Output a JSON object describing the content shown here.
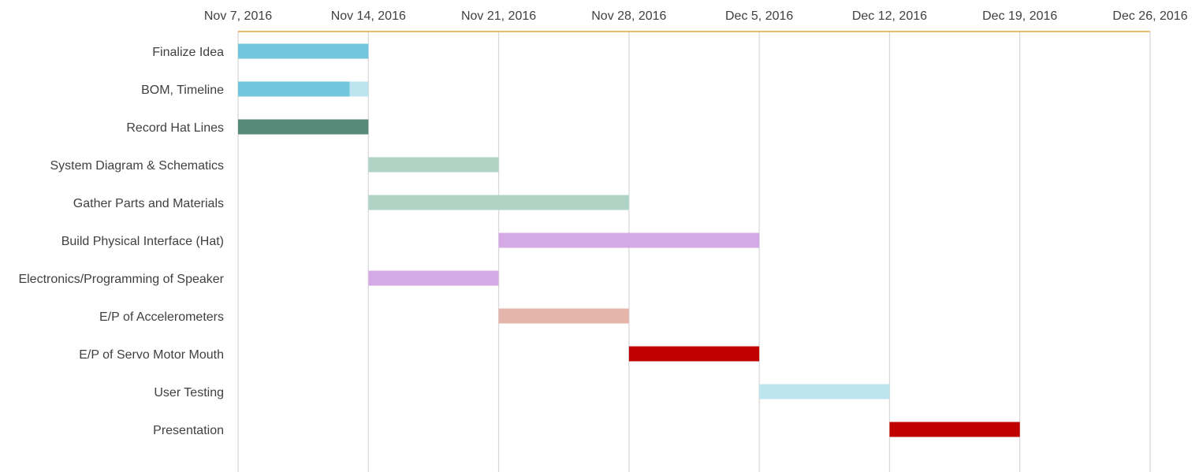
{
  "chart_data": {
    "type": "gantt",
    "title": "",
    "xlabel": "",
    "ylabel": "",
    "x_axis_position": "top",
    "x_ticks": [
      "Nov 7, 2016",
      "Nov 14, 2016",
      "Nov 21, 2016",
      "Nov 28, 2016",
      "Dec 5, 2016",
      "Dec 12, 2016",
      "Dec 19, 2016",
      "Dec 26, 2016"
    ],
    "xlim": [
      "2016-11-07",
      "2016-12-26"
    ],
    "grid": true,
    "legend": "none",
    "colors": {
      "axis_line": "#e8a33d",
      "gridline": "#d9d9d9"
    },
    "tasks": [
      {
        "name": "Finalize Idea",
        "start": "2016-11-07",
        "end": "2016-11-14",
        "segments": [
          {
            "start": "2016-11-07",
            "end": "2016-11-14",
            "color": "#72c7de"
          }
        ]
      },
      {
        "name": "BOM, Timeline",
        "start": "2016-11-07",
        "end": "2016-11-14",
        "segments": [
          {
            "start": "2016-11-07",
            "end": "2016-11-13",
            "color": "#72c7de"
          },
          {
            "start": "2016-11-13",
            "end": "2016-11-14",
            "color": "#bde5f0"
          }
        ]
      },
      {
        "name": "Record Hat Lines",
        "start": "2016-11-07",
        "end": "2016-11-14",
        "segments": [
          {
            "start": "2016-11-07",
            "end": "2016-11-14",
            "color": "#548a77"
          }
        ]
      },
      {
        "name": "System Diagram & Schematics",
        "start": "2016-11-14",
        "end": "2016-11-21",
        "segments": [
          {
            "start": "2016-11-14",
            "end": "2016-11-21",
            "color": "#afd4c5"
          }
        ]
      },
      {
        "name": "Gather Parts and Materials",
        "start": "2016-11-14",
        "end": "2016-11-28",
        "segments": [
          {
            "start": "2016-11-14",
            "end": "2016-11-28",
            "color": "#afd4c5"
          }
        ]
      },
      {
        "name": "Build Physical Interface (Hat)",
        "start": "2016-11-21",
        "end": "2016-12-05",
        "segments": [
          {
            "start": "2016-11-21",
            "end": "2016-12-05",
            "color": "#d5a9e6"
          }
        ]
      },
      {
        "name": "Electronics/Programming of Speaker",
        "start": "2016-11-14",
        "end": "2016-11-21",
        "segments": [
          {
            "start": "2016-11-14",
            "end": "2016-11-21",
            "color": "#d5a9e6"
          }
        ]
      },
      {
        "name": "E/P of Accelerometers",
        "start": "2016-11-21",
        "end": "2016-11-28",
        "segments": [
          {
            "start": "2016-11-21",
            "end": "2016-11-28",
            "color": "#e5b4ab"
          }
        ]
      },
      {
        "name": "E/P of Servo Motor Mouth",
        "start": "2016-11-28",
        "end": "2016-12-05",
        "segments": [
          {
            "start": "2016-11-28",
            "end": "2016-12-05",
            "color": "#c00000"
          }
        ]
      },
      {
        "name": "User Testing",
        "start": "2016-12-05",
        "end": "2016-12-12",
        "segments": [
          {
            "start": "2016-12-05",
            "end": "2016-12-12",
            "color": "#bde5f0"
          }
        ]
      },
      {
        "name": "Presentation",
        "start": "2016-12-12",
        "end": "2016-12-19",
        "segments": [
          {
            "start": "2016-12-12",
            "end": "2016-12-19",
            "color": "#c00000"
          }
        ]
      }
    ]
  }
}
